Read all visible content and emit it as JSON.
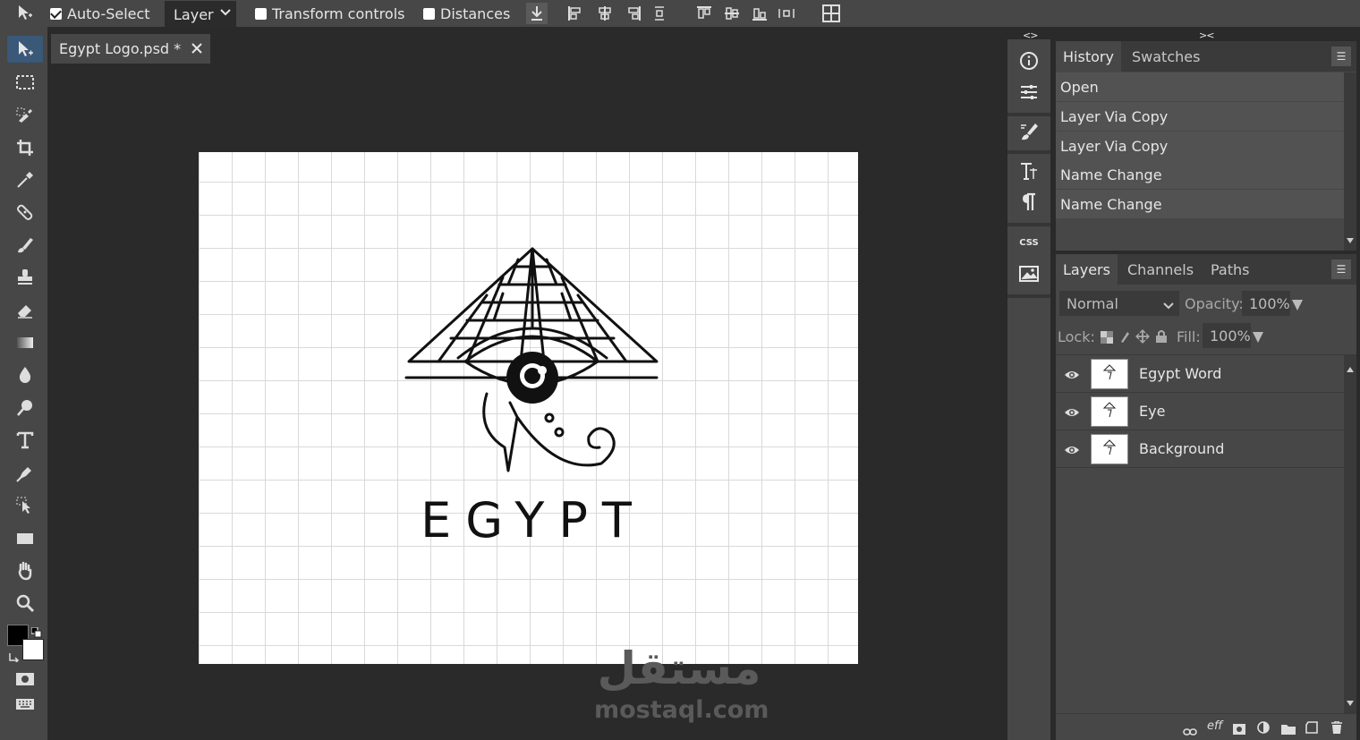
{
  "topbar": {
    "auto_select_label": "Auto-Select",
    "auto_select_checked": true,
    "layer_select_value": "Layer",
    "transform_controls_label": "Transform controls",
    "distances_label": "Distances"
  },
  "document": {
    "tab_title": "Egypt Logo.psd *",
    "logo_text": "EGYPT"
  },
  "watermark": {
    "arabic": "مستقل",
    "latin": "mostaql.com"
  },
  "strip": {
    "css_label": "CSS"
  },
  "history": {
    "tabs": [
      "History",
      "Swatches"
    ],
    "items": [
      "Open",
      "Layer Via Copy",
      "Layer Via Copy",
      "Name Change",
      "Name Change"
    ]
  },
  "layers": {
    "tabs": [
      "Layers",
      "Channels",
      "Paths"
    ],
    "blend_mode": "Normal",
    "opacity_label": "Opacity:",
    "opacity_value": "100%",
    "lock_label": "Lock:",
    "fill_label": "Fill:",
    "fill_value": "100%",
    "items": [
      {
        "name": "Egypt Word"
      },
      {
        "name": "Eye"
      },
      {
        "name": "Background"
      }
    ],
    "footer_eff_label": "eff"
  },
  "colors": {
    "foreground": "#000000",
    "background": "#ffffff",
    "active_tool": "#3a5878"
  }
}
